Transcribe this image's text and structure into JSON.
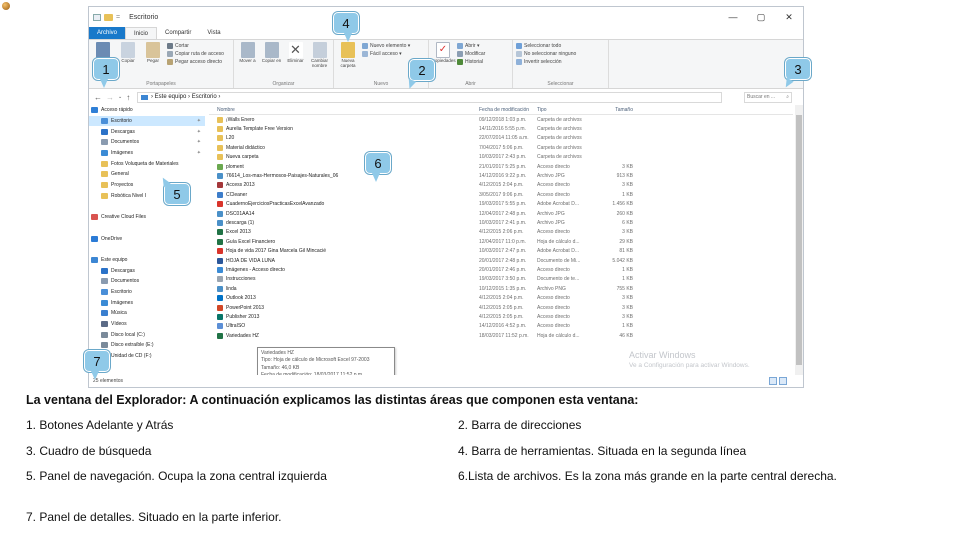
{
  "window": {
    "title": "Escritorio",
    "controls": [
      "—",
      "▢",
      "✕"
    ],
    "tabs": [
      "Archivo",
      "Inicio",
      "Compartir",
      "Vista"
    ]
  },
  "ribbon": {
    "groups": [
      {
        "label": "Portapapeles",
        "big": [
          "Anclar al Acceso rápido",
          "Copiar",
          "Pegar"
        ],
        "small": [
          "Cortar",
          "Copiar ruta de acceso",
          "Pegar acceso directo"
        ]
      },
      {
        "label": "Organizar",
        "big": [
          "Mover a",
          "Copiar en",
          "Eliminar",
          "Cambiar nombre"
        ],
        "small": []
      },
      {
        "label": "Nuevo",
        "big": [
          "Nueva carpeta"
        ],
        "small": [
          "Nuevo elemento ▾",
          "Fácil acceso ▾"
        ]
      },
      {
        "label": "Abrir",
        "big": [
          "Propiedades"
        ],
        "small": [
          "Abrir ▾",
          "Modificar",
          "Historial"
        ]
      },
      {
        "label": "Seleccionar",
        "big": [],
        "small": [
          "Seleccionar todo",
          "No seleccionar ninguno",
          "Invertir selección"
        ]
      }
    ]
  },
  "address": {
    "path": "›  Este equipo  ›  Escritorio  ›",
    "search_placeholder": "Buscar en ..."
  },
  "nav_pane": {
    "items": [
      {
        "label": "Acceso rápido",
        "icon": "star-icon",
        "color": "#2f7fd6",
        "indent": 2
      },
      {
        "label": "Escritorio",
        "icon": "desktop-icon",
        "color": "#4a8fd8",
        "indent": 12,
        "selected": true,
        "pin": true
      },
      {
        "label": "Descargas",
        "icon": "download-icon",
        "color": "#2b72c8",
        "indent": 12,
        "pin": true
      },
      {
        "label": "Documentos",
        "icon": "documents-icon",
        "color": "#8a9bb0",
        "indent": 12,
        "pin": true
      },
      {
        "label": "Imágenes",
        "icon": "pictures-icon",
        "color": "#3b8bd5",
        "indent": 12,
        "pin": true
      },
      {
        "label": "Fotos Voluqueta de Materiales",
        "icon": "folder-icon",
        "color": "#e8c158",
        "indent": 12
      },
      {
        "label": "General",
        "icon": "folder-icon",
        "color": "#e8c158",
        "indent": 12
      },
      {
        "label": "Proyectos",
        "icon": "folder-icon",
        "color": "#e8c158",
        "indent": 12
      },
      {
        "label": "Robótica Nivel I",
        "icon": "folder-icon",
        "color": "#e8c158",
        "indent": 12
      },
      {
        "label": "",
        "icon": "",
        "color": "#ffffff",
        "indent": 12
      },
      {
        "label": "Creative Cloud Files",
        "icon": "cloud-icon",
        "color": "#d9534f",
        "indent": 2
      },
      {
        "label": "",
        "icon": "",
        "color": "#ffffff",
        "indent": 2
      },
      {
        "label": "OneDrive",
        "icon": "onedrive-icon",
        "color": "#2b7bd6",
        "indent": 2
      },
      {
        "label": "",
        "icon": "",
        "color": "#ffffff",
        "indent": 2
      },
      {
        "label": "Este equipo",
        "icon": "computer-icon",
        "color": "#3c86d3",
        "indent": 2
      },
      {
        "label": "Descargas",
        "icon": "download-icon",
        "color": "#2b72c8",
        "indent": 12
      },
      {
        "label": "Documentos",
        "icon": "documents-icon",
        "color": "#8a9bb0",
        "indent": 12
      },
      {
        "label": "Escritorio",
        "icon": "desktop-icon",
        "color": "#4a8fd8",
        "indent": 12
      },
      {
        "label": "Imágenes",
        "icon": "pictures-icon",
        "color": "#3b8bd5",
        "indent": 12
      },
      {
        "label": "Música",
        "icon": "music-icon",
        "color": "#3a7fcf",
        "indent": 12
      },
      {
        "label": "Vídeos",
        "icon": "videos-icon",
        "color": "#5b6b86",
        "indent": 12
      },
      {
        "label": "Disco local (C:)",
        "icon": "drive-icon",
        "color": "#7a8a9a",
        "indent": 12
      },
      {
        "label": "Disco extraíble (E:)",
        "icon": "drive-icon",
        "color": "#7a8a9a",
        "indent": 12
      },
      {
        "label": "Unidad de CD (F:)",
        "icon": "drive-icon",
        "color": "#7a8a9a",
        "indent": 12
      },
      {
        "label": "",
        "icon": "",
        "color": "#ffffff",
        "indent": 12
      }
    ]
  },
  "files": {
    "columns": [
      "Nombre",
      "Fecha de modificación",
      "Tipo",
      "Tamaño"
    ],
    "rows": [
      {
        "name": "¡Walls Enero",
        "date": "09/12/2018 1:03 p.m.",
        "type": "Carpeta de archivos",
        "size": "",
        "color": "#e8c158"
      },
      {
        "name": "Aurelia Template Free Version",
        "date": "14/11/2016 5:55 p.m.",
        "type": "Carpeta de archivos",
        "size": "",
        "color": "#e8c158"
      },
      {
        "name": "L20",
        "date": "22/07/2014 11:05 a.m.",
        "type": "Carpeta de archivos",
        "size": "",
        "color": "#e8c158"
      },
      {
        "name": "Material didáctico",
        "date": "7/04/2017 5:06 p.m.",
        "type": "Carpeta de archivos",
        "size": "",
        "color": "#e8c158"
      },
      {
        "name": "Nueva carpeta",
        "date": "10/03/2017 2:43 p.m.",
        "type": "Carpeta de archivos",
        "size": "",
        "color": "#e8c158"
      },
      {
        "name": "ploment",
        "date": "21/01/2017 5:25 p.m.",
        "type": "Acceso directo",
        "size": "3 KB",
        "color": "#6aa84f"
      },
      {
        "name": "76614_Los-mas-Hermosos-Paisajes-Naturales_06",
        "date": "14/12/2016 9:22 p.m.",
        "type": "Archivo JPG",
        "size": "913 KB",
        "color": "#4a90c8"
      },
      {
        "name": "Access 2013",
        "date": "4/12/2015 2:04 p.m.",
        "type": "Acceso directo",
        "size": "3 KB",
        "color": "#a4373a"
      },
      {
        "name": "CCleaner",
        "date": "3/05/2017 9:06 p.m.",
        "type": "Acceso directo",
        "size": "1 KB",
        "color": "#3d7dca"
      },
      {
        "name": "CuadernoEjerciciosPracticasExcelAvanzado",
        "date": "19/03/2017 5:55 p.m.",
        "type": "Adobe Acrobat D...",
        "size": "1.456 KB",
        "color": "#d9342b"
      },
      {
        "name": "DSC01AA14",
        "date": "12/04/2017 2:48 p.m.",
        "type": "Archivo JPG",
        "size": "260 KB",
        "color": "#4a90c8"
      },
      {
        "name": "descarga (1)",
        "date": "10/03/2017 2:41 p.m.",
        "type": "Archivo JPG",
        "size": "6 KB",
        "color": "#4a90c8"
      },
      {
        "name": "Excel 2013",
        "date": "4/12/2015 2:06 p.m.",
        "type": "Acceso directo",
        "size": "3 KB",
        "color": "#217346"
      },
      {
        "name": "Guía Excel Financiero",
        "date": "12/04/2017 11:0 p.m.",
        "type": "Hoja de cálculo d...",
        "size": "29 KB",
        "color": "#217346"
      },
      {
        "name": "Hoja de vida 2017 Gina Marcela Gil Mincacié",
        "date": "10/03/2017 2:47 p.m.",
        "type": "Adobe Acrobat D...",
        "size": "81 KB",
        "color": "#d9342b"
      },
      {
        "name": "HOJA DE VIDA LUNA",
        "date": "20/01/2017 2:48 p.m.",
        "type": "Documento de Mi...",
        "size": "5.042 KB",
        "color": "#2b579a"
      },
      {
        "name": "Imágenes - Acceso directo",
        "date": "20/01/2017 2:46 p.m.",
        "type": "Acceso directo",
        "size": "1 KB",
        "color": "#3b8bd5"
      },
      {
        "name": "Instrucciones",
        "date": "19/03/2017 3:50 p.m.",
        "type": "Documento de te...",
        "size": "1 KB",
        "color": "#9aa5b1"
      },
      {
        "name": "linda",
        "date": "10/12/2015 1:35 p.m.",
        "type": "Archivo PNG",
        "size": "755 KB",
        "color": "#4a90c8"
      },
      {
        "name": "Outlook 2013",
        "date": "4/12/2015 2:04 p.m.",
        "type": "Acceso directo",
        "size": "3 KB",
        "color": "#0072c6"
      },
      {
        "name": "PowerPoint 2013",
        "date": "4/12/2015 2:05 p.m.",
        "type": "Acceso directo",
        "size": "3 KB",
        "color": "#d24726"
      },
      {
        "name": "Publisher 2013",
        "date": "4/12/2015 2:05 p.m.",
        "type": "Acceso directo",
        "size": "3 KB",
        "color": "#077568"
      },
      {
        "name": "UltraISO",
        "date": "14/12/2016 4:52 p.m.",
        "type": "Acceso directo",
        "size": "1 KB",
        "color": "#5c8fd6"
      },
      {
        "name": "Variedades HZ",
        "date": "18/03/2017 11:52 p.m.",
        "type": "Hoja de cálculo d...",
        "size": "46 KB",
        "color": "#217346"
      }
    ]
  },
  "tooltip": {
    "lines": [
      "Variedades HZ",
      "Tipo: Hoja de cálculo de Microsoft Excel 97-2003",
      "Tamaño: 46,0 KB",
      "Fecha de modificación: 18/03/2017 11:52 p.m."
    ]
  },
  "statusbar": {
    "text": "25 elementos"
  },
  "watermark": {
    "line1": "Activar Windows",
    "line2": "Ve a Configuración para activar Windows."
  },
  "callouts": [
    {
      "num": "1"
    },
    {
      "num": "2"
    },
    {
      "num": "3"
    },
    {
      "num": "4"
    },
    {
      "num": "5"
    },
    {
      "num": "6"
    },
    {
      "num": "7"
    }
  ],
  "caption": "La ventana del Explorador: A continuación explicamos las distintas áreas que componen esta ventana:",
  "items": [
    "1. Botones Adelante y Atrás",
    "2. Barra de direcciones",
    "3. Cuadro de búsqueda",
    "4. Barra de herramientas. Situada en la segunda línea",
    "5. Panel de navegación. Ocupa la zona central izquierda",
    "6.Lista  de archivos. Es la zona más grande en la parte central derecha.",
    "7. Panel de detalles. Situado en la parte inferior."
  ]
}
